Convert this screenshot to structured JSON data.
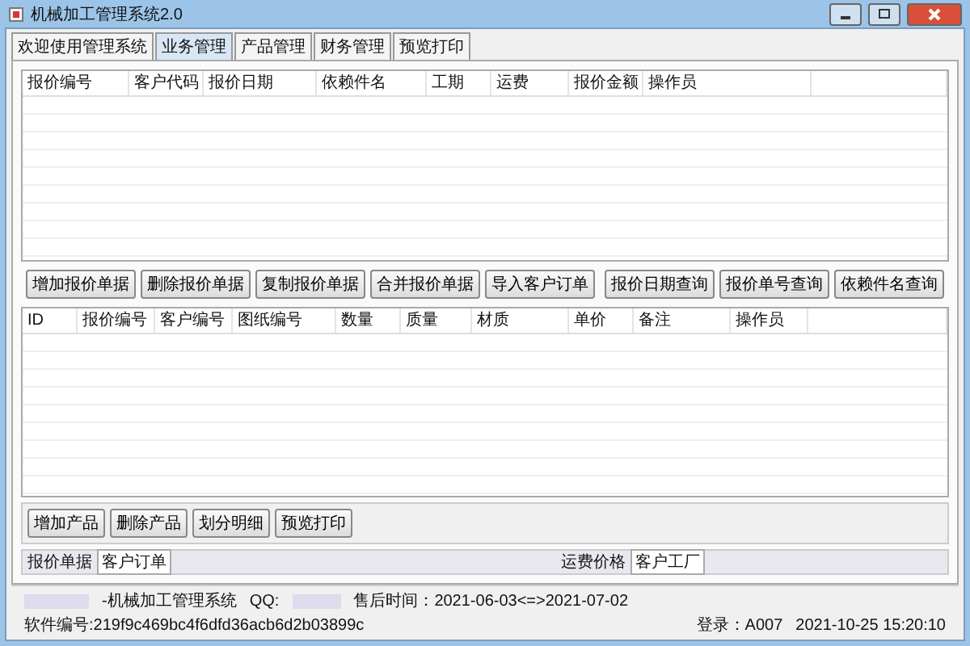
{
  "window": {
    "title": "机械加工管理系统2.0"
  },
  "main_tabs": [
    {
      "label": "欢迎使用管理系统",
      "selected": false
    },
    {
      "label": "业务管理",
      "selected": true
    },
    {
      "label": "产品管理",
      "selected": false
    },
    {
      "label": "财务管理",
      "selected": false
    },
    {
      "label": "预览打印",
      "selected": false
    }
  ],
  "quote_table": {
    "columns": [
      "报价编号",
      "客户代码",
      "报价日期",
      "依赖件名",
      "工期",
      "运费",
      "报价金额",
      "操作员"
    ]
  },
  "quote_buttons_left": [
    "增加报价单据",
    "删除报价单据",
    "复制报价单据",
    "合并报价单据",
    "导入客户订单"
  ],
  "quote_buttons_right": [
    "报价日期查询",
    "报价单号查询",
    "依赖件名查询"
  ],
  "detail_table": {
    "columns": [
      "ID",
      "报价编号",
      "客户编号",
      "图纸编号",
      "数量",
      "质量",
      "材质",
      "单价",
      "备注",
      "操作员"
    ]
  },
  "detail_buttons": [
    "增加产品",
    "删除产品",
    "划分明细",
    "预览打印"
  ],
  "bottom_tabs_left": [
    {
      "label": "报价单据",
      "selected": true
    },
    {
      "label": "客户订单",
      "selected": false
    }
  ],
  "bottom_tabs_right": [
    {
      "label": "运费价格",
      "selected": true
    },
    {
      "label": "客户工厂",
      "selected": false
    }
  ],
  "status_bar": {
    "app_name": "-机械加工管理系统",
    "qq": "QQ:",
    "service": "售后时间：2021-06-03<=>2021-07-02",
    "software_id": "软件编号:219f9c469bc4f6dfd36acb6d2b03899c",
    "login": "登录：A007",
    "time": "2021-10-25 15:20:10"
  }
}
